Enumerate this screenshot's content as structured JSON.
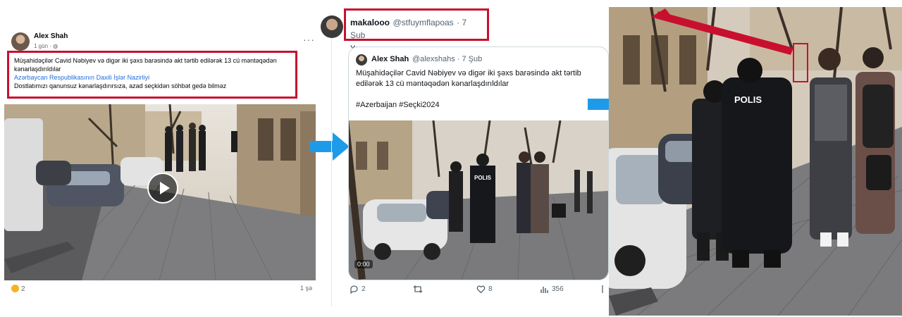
{
  "facebook_post": {
    "author": "Alex Shah",
    "time": "1 gün · ",
    "text_line1": "Müşahidəçilər Cavid Nəbiyev və digər iki şəxs barəsində akt tərtib edilərək 13 cü məntəqədən kənarlaşdırıldılar",
    "link_text": "Azərbaycan Respublikasının Daxili İşlər Nazirliyi",
    "text_line3": "Dostlatımızı qanunsuz kənarlaşdırırsıza, azad seçkidən söhbət gedə bilməz",
    "reaction_count": "2",
    "shares": "1 şə"
  },
  "tweet": {
    "display_name": "makalooo",
    "handle": "@stfuymflapoas",
    "date": "· 7 Şub",
    "reply_text": "Yazıq canım.",
    "quoted": {
      "author": "Alex Shah",
      "handle": "@alexshahs",
      "date": "· 7 Şub",
      "text": "Müşahidəçilər Cavid Nəbiyev və digər iki şəxs barəsində akt tərtib edilərək 13 cü məntəqədən kənarlaşdırıldılar",
      "hashtags": "#Azerbaijan #Seçki2024",
      "video_time": "0:00"
    },
    "actions": {
      "replies": "2",
      "likes": "8",
      "views": "356"
    }
  },
  "zoom_photo": {
    "uniform_label": "POLIS"
  },
  "colors": {
    "highlight_red": "#c8102e",
    "arrow_blue": "#1e9be8",
    "link_blue": "#216fdb"
  },
  "icons": [
    "more-dots-icon",
    "play-icon",
    "reply-icon",
    "retweet-icon",
    "like-icon",
    "views-icon",
    "arrow-right-icon"
  ]
}
